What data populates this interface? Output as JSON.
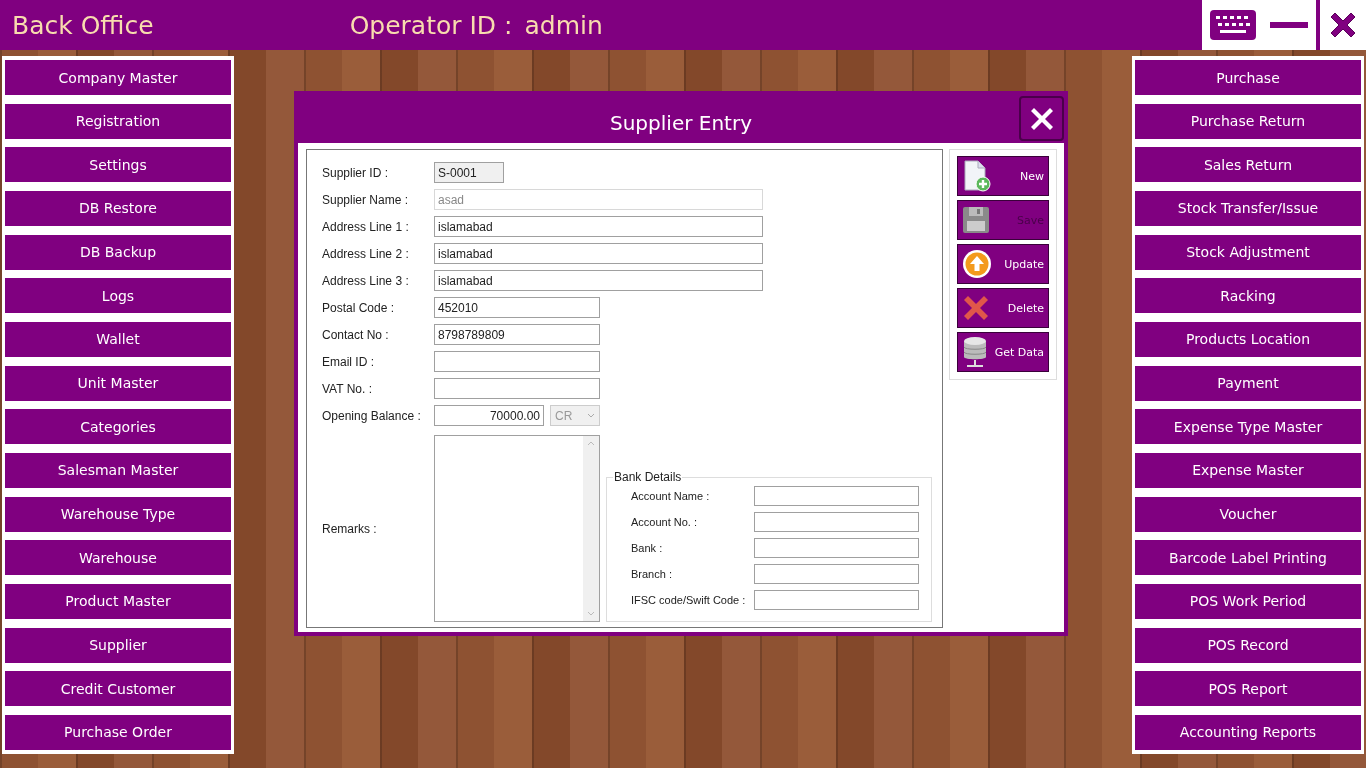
{
  "header": {
    "title": "Back Office",
    "operator_label": "Operator ID :",
    "operator": "admin"
  },
  "left_menu": [
    "Company Master",
    "Registration",
    "Settings",
    "DB Restore",
    "DB Backup",
    "Logs",
    "Wallet",
    "Unit Master",
    "Categories",
    "Salesman Master",
    "Warehouse Type",
    "Warehouse",
    "Product Master",
    "Supplier",
    "Credit Customer",
    "Purchase Order"
  ],
  "right_menu": [
    "Purchase",
    "Purchase Return",
    "Sales Return",
    "Stock Transfer/Issue",
    "Stock Adjustment",
    "Racking",
    "Products Location",
    "Payment",
    "Expense Type Master",
    "Expense Master",
    "Voucher",
    "Barcode Label Printing",
    "POS Work Period",
    "POS Record",
    "POS Report",
    "Accounting Reports"
  ],
  "dialog": {
    "title": "Supplier Entry",
    "fields": [
      {
        "label": "Supplier ID :",
        "value": "S-0001",
        "kind": "id",
        "disabled": false
      },
      {
        "label": "Supplier Name :",
        "value": "asad",
        "kind": "long",
        "disabled": true
      },
      {
        "label": "Address Line 1 :",
        "value": "islamabad",
        "kind": "long",
        "disabled": false
      },
      {
        "label": "Address Line 2 :",
        "value": "islamabad",
        "kind": "long",
        "disabled": false
      },
      {
        "label": "Address Line 3 :",
        "value": "islamabad",
        "kind": "long",
        "disabled": false
      },
      {
        "label": "Postal Code :",
        "value": "452010",
        "kind": "short",
        "disabled": false
      },
      {
        "label": "Contact No :",
        "value": "8798789809",
        "kind": "short",
        "disabled": false
      },
      {
        "label": "Email ID :",
        "kind": "short",
        "disabled": false
      },
      {
        "label": "VAT No. :",
        "kind": "short",
        "disabled": false
      },
      {
        "label": "Opening Balance :",
        "value": "70000.00",
        "kind": "balance",
        "disabled": false,
        "type_value": "CR",
        "type_disabled": true
      }
    ],
    "remarks": {
      "label": "Remarks :"
    },
    "bank_details": {
      "title": "Bank Details",
      "fields": [
        "Account Name :",
        "Account No. :",
        "Bank :",
        "Branch :",
        "IFSC code/Swift Code :"
      ]
    },
    "actions": [
      {
        "label": "New",
        "kind": "new",
        "disabled": false
      },
      {
        "label": "Save",
        "kind": "save",
        "disabled": true
      },
      {
        "label": "Update",
        "kind": "update",
        "disabled": false
      },
      {
        "label": "Delete",
        "kind": "delete",
        "disabled": false
      },
      {
        "label": "Get Data",
        "kind": "data",
        "disabled": false
      }
    ]
  }
}
